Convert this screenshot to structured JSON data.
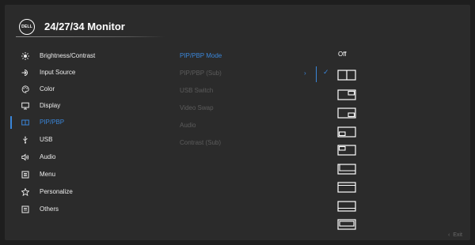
{
  "header": {
    "logo_text": "DELL",
    "title": "24/27/34 Monitor"
  },
  "menu": {
    "items": [
      {
        "label": "Brightness/Contrast",
        "icon": "brightness-icon"
      },
      {
        "label": "Input Source",
        "icon": "input-source-icon"
      },
      {
        "label": "Color",
        "icon": "color-palette-icon"
      },
      {
        "label": "Display",
        "icon": "display-icon"
      },
      {
        "label": "PIP/PBP",
        "icon": "pip-pbp-icon",
        "active": true
      },
      {
        "label": "USB",
        "icon": "usb-icon"
      },
      {
        "label": "Audio",
        "icon": "audio-icon"
      },
      {
        "label": "Menu",
        "icon": "menu-icon"
      },
      {
        "label": "Personalize",
        "icon": "star-icon"
      },
      {
        "label": "Others",
        "icon": "others-icon"
      }
    ]
  },
  "submenu": {
    "items": [
      {
        "label": "PIP/PBP Mode",
        "active": true
      },
      {
        "label": "PIP/PBP (Sub)"
      },
      {
        "label": "USB Switch"
      },
      {
        "label": "Video Swap"
      },
      {
        "label": "Audio"
      },
      {
        "label": "Contrast (Sub)"
      }
    ]
  },
  "options": {
    "off_label": "Off",
    "selected_index": 0,
    "icons": [
      "pbp-split-icon",
      "pip-top-right-icon",
      "pip-bottom-right-icon",
      "pip-bottom-left-icon",
      "pip-top-left-icon",
      "pbp-bottom-split-icon",
      "pbp-horizontal-split-icon",
      "pbp-wide-top-icon",
      "pbp-wide-bottom-icon"
    ]
  },
  "footer": {
    "exit_label": "Exit"
  },
  "colors": {
    "accent": "#3a86d9",
    "background": "#2b2b2b",
    "text": "#ececec",
    "disabled_text": "#5c5c5c"
  }
}
